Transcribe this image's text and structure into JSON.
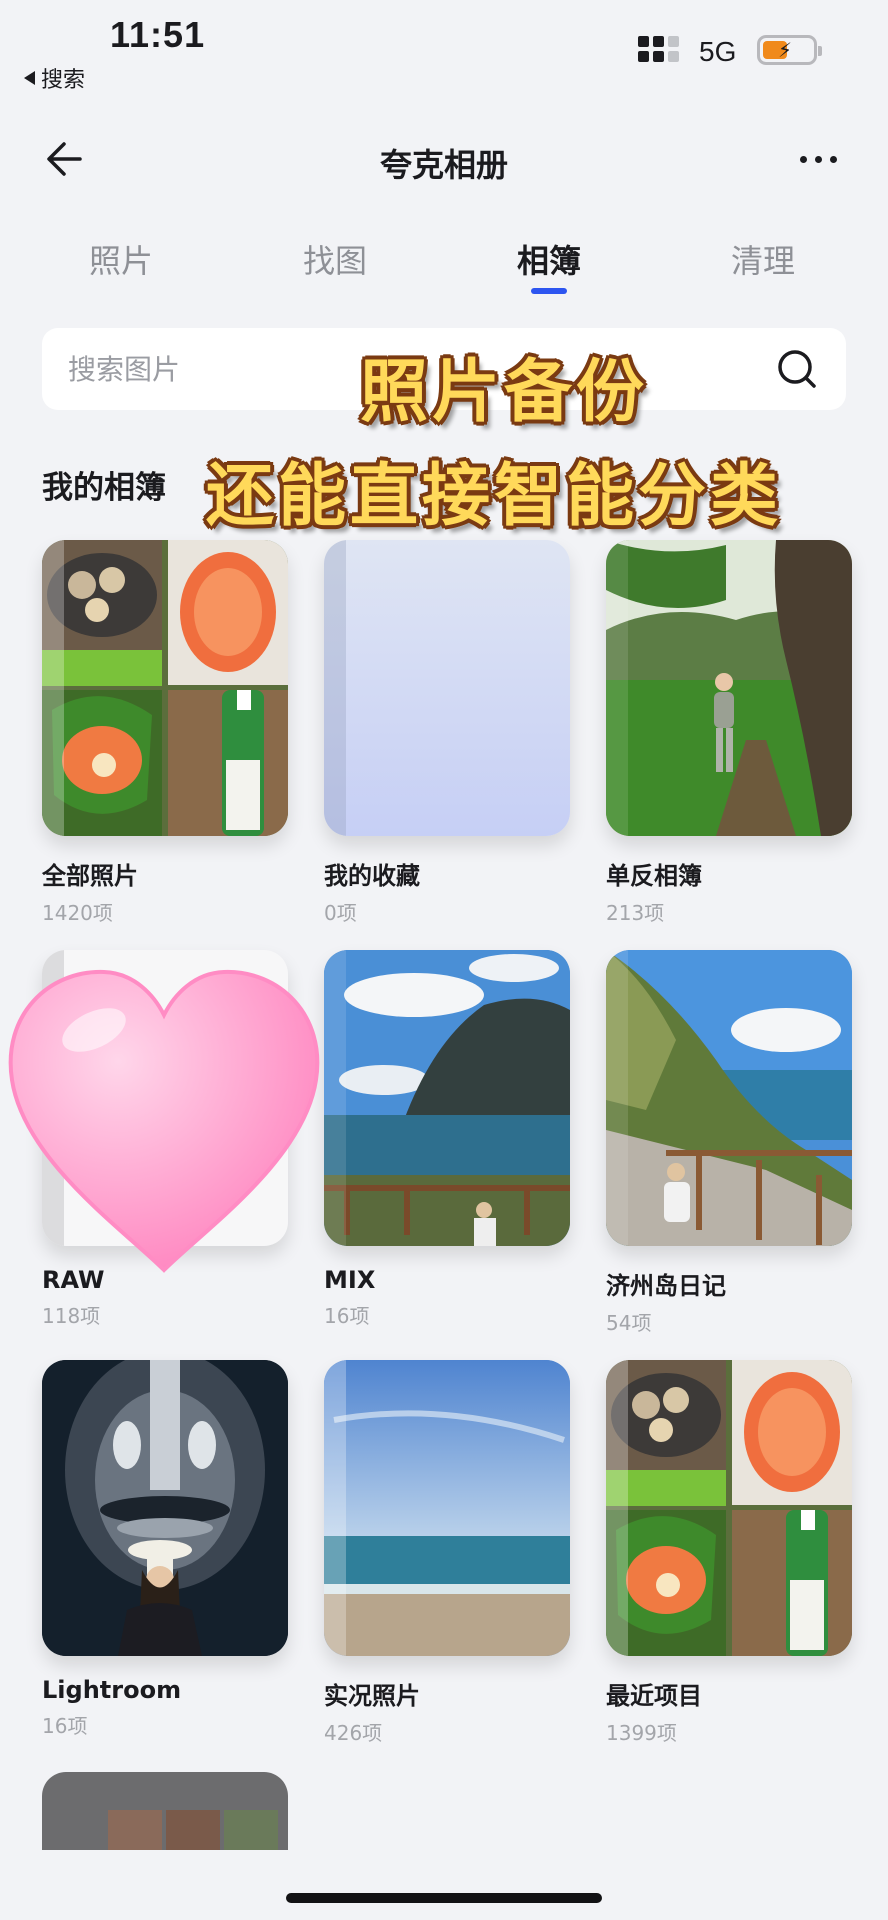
{
  "status_bar": {
    "time": "11:51",
    "back_app": "搜索",
    "network": "5G"
  },
  "header": {
    "title": "夸克相册"
  },
  "tabs": [
    {
      "label": "照片",
      "active": false
    },
    {
      "label": "找图",
      "active": false
    },
    {
      "label": "相簿",
      "active": true
    },
    {
      "label": "清理",
      "active": false
    }
  ],
  "search": {
    "placeholder": "搜索图片"
  },
  "overlay_caption": {
    "line1": "照片备份",
    "line2": "还能直接智能分类"
  },
  "section": {
    "title": "我的相簿"
  },
  "albums": [
    {
      "name": "全部照片",
      "count": "1420项"
    },
    {
      "name": "我的收藏",
      "count": "0项"
    },
    {
      "name": "单反相簿",
      "count": "213项"
    },
    {
      "name": "RAW",
      "count": "118项"
    },
    {
      "name": "MIX",
      "count": "16项"
    },
    {
      "name": "济州岛日记",
      "count": "54项"
    },
    {
      "name": "Lightroom",
      "count": "16项"
    },
    {
      "name": "实况照片",
      "count": "426项"
    },
    {
      "name": "最近项目",
      "count": "1399项"
    }
  ],
  "colors": {
    "accent": "#2d55f0",
    "caption_fill": "#ffd95a",
    "caption_stroke": "#7a3a12"
  }
}
